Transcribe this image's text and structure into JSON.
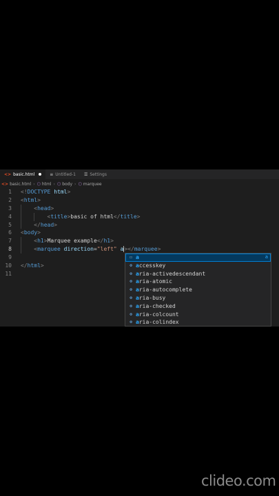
{
  "tabs": [
    {
      "label": "basic.html",
      "icon": "html-file-icon",
      "active": true,
      "modified": true
    },
    {
      "label": "Untitled-1",
      "icon": "file-icon",
      "active": false
    },
    {
      "label": "Settings",
      "icon": "settings-icon",
      "active": false
    }
  ],
  "breadcrumb": [
    "basic.html",
    "html",
    "body",
    "marquee"
  ],
  "lines": [
    {
      "n": "1",
      "indent": 0,
      "tokens": [
        [
          "brk",
          "<!"
        ],
        [
          "tag",
          "DOCTYPE"
        ],
        [
          "plain",
          " "
        ],
        [
          "attr",
          "html"
        ],
        [
          "brk",
          ">"
        ]
      ]
    },
    {
      "n": "2",
      "indent": 0,
      "tokens": [
        [
          "brk",
          "<"
        ],
        [
          "tag",
          "html"
        ],
        [
          "brk",
          ">"
        ]
      ]
    },
    {
      "n": "3",
      "indent": 1,
      "tokens": [
        [
          "brk",
          "<"
        ],
        [
          "tag",
          "head"
        ],
        [
          "brk",
          ">"
        ]
      ]
    },
    {
      "n": "4",
      "indent": 2,
      "tokens": [
        [
          "brk",
          "<"
        ],
        [
          "tag",
          "title"
        ],
        [
          "brk",
          ">"
        ],
        [
          "plain",
          "basic of html"
        ],
        [
          "brk",
          "</"
        ],
        [
          "tag",
          "title"
        ],
        [
          "brk",
          ">"
        ]
      ]
    },
    {
      "n": "5",
      "indent": 1,
      "tokens": [
        [
          "brk",
          "</"
        ],
        [
          "tag",
          "head"
        ],
        [
          "brk",
          ">"
        ]
      ]
    },
    {
      "n": "6",
      "indent": 0,
      "tokens": [
        [
          "brk",
          "<"
        ],
        [
          "tag",
          "body"
        ],
        [
          "brk",
          ">"
        ]
      ]
    },
    {
      "n": "7",
      "indent": 1,
      "tokens": [
        [
          "brk",
          "<"
        ],
        [
          "tag",
          "h1"
        ],
        [
          "brk",
          ">"
        ],
        [
          "plain",
          "Marquee example"
        ],
        [
          "brk",
          "</"
        ],
        [
          "tag",
          "h1"
        ],
        [
          "brk",
          ">"
        ]
      ]
    },
    {
      "n": "8",
      "indent": 1,
      "current": true,
      "tokens": [
        [
          "brk",
          "<"
        ],
        [
          "tag",
          "marquee"
        ],
        [
          "plain",
          " "
        ],
        [
          "attr",
          "direction"
        ],
        [
          "plain",
          "="
        ],
        [
          "str",
          "\"left\""
        ],
        [
          "plain",
          " "
        ],
        [
          "attr",
          "a"
        ],
        [
          "cursor",
          ""
        ],
        [
          "brk",
          "></"
        ],
        [
          "tag",
          "marquee"
        ],
        [
          "brk",
          ">"
        ]
      ]
    },
    {
      "n": "9",
      "indent": 0,
      "tokens": []
    },
    {
      "n": "10",
      "indent": 0,
      "tokens": [
        [
          "brk",
          "</"
        ],
        [
          "tag",
          "html"
        ],
        [
          "brk",
          ">"
        ]
      ]
    },
    {
      "n": "11",
      "indent": 0,
      "tokens": []
    }
  ],
  "suggestions": {
    "items": [
      {
        "label": "a",
        "kind": "square",
        "selected": true,
        "detail": "a"
      },
      {
        "label": "accesskey",
        "kind": "property"
      },
      {
        "label": "aria-activedescendant",
        "kind": "property"
      },
      {
        "label": "aria-atomic",
        "kind": "property"
      },
      {
        "label": "aria-autocomplete",
        "kind": "property"
      },
      {
        "label": "aria-busy",
        "kind": "property"
      },
      {
        "label": "aria-checked",
        "kind": "property"
      },
      {
        "label": "aria-colcount",
        "kind": "property"
      },
      {
        "label": "aria-colindex",
        "kind": "property"
      }
    ]
  },
  "watermark": "clideo.com",
  "colors": {
    "editor_bg": "#1e1e1e",
    "tag": "#569cd6",
    "attribute": "#9cdcfe",
    "string": "#ce9178",
    "bracket": "#808080",
    "selection": "#04395e"
  }
}
